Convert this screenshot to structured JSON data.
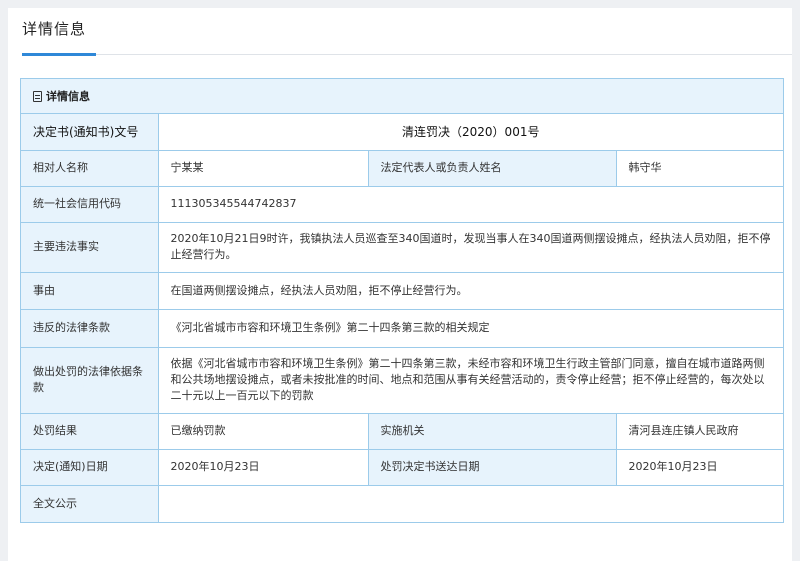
{
  "page": {
    "title": "详情信息"
  },
  "panel": {
    "header": "详情信息"
  },
  "decision_no": {
    "label": "决定书(通知书)文号",
    "value": "清连罚决（2020）001号"
  },
  "party": {
    "name_label": "相对人名称",
    "name_value": "宁某某",
    "legal_rep_label": "法定代表人或负责人姓名",
    "legal_rep_value": "韩守华"
  },
  "credit_code": {
    "label": "统一社会信用代码",
    "value": "111305345544742837"
  },
  "violation_facts": {
    "label": "主要违法事实",
    "value": "2020年10月21日9时许，我镇执法人员巡查至340国道时，发现当事人在340国道两侧摆设摊点，经执法人员劝阻，拒不停止经营行为。"
  },
  "reason": {
    "label": "事由",
    "value": "在国道两侧摆设摊点，经执法人员劝阻，拒不停止经营行为。"
  },
  "violated_law": {
    "label": "违反的法律条款",
    "value": "《河北省城市市容和环境卫生条例》第二十四条第三款的相关规定"
  },
  "penalty_basis": {
    "label": "做出处罚的法律依据条款",
    "value": "依据《河北省城市市容和环境卫生条例》第二十四条第三款，未经市容和环境卫生行政主管部门同意，擅自在城市道路两侧和公共场地摆设摊点，或者未按批准的时间、地点和范围从事有关经营活动的，责令停止经营；拒不停止经营的，每次处以二十元以上一百元以下的罚款"
  },
  "result": {
    "label": "处罚结果",
    "value": "已缴纳罚款",
    "agency_label": "实施机关",
    "agency_value": "清河县连庄镇人民政府"
  },
  "dates": {
    "decision_label": "决定(通知)日期",
    "decision_value": "2020年10月23日",
    "delivery_label": "处罚决定书送达日期",
    "delivery_value": "2020年10月23日"
  },
  "full_text": {
    "label": "全文公示",
    "value": ""
  }
}
